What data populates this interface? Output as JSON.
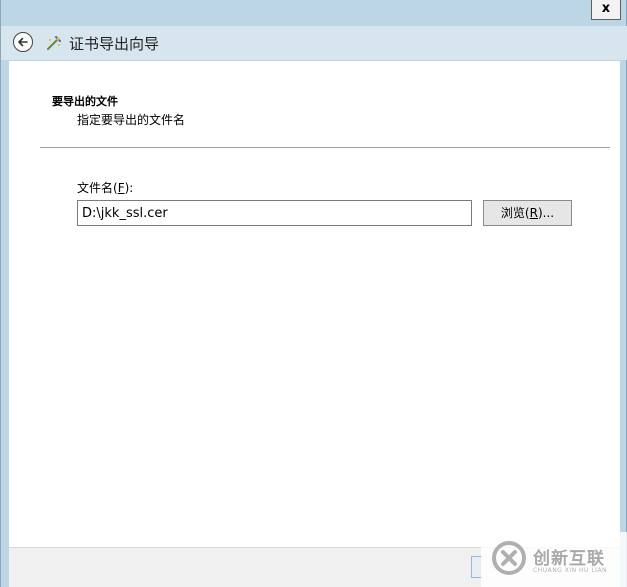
{
  "window": {
    "close_label": "x"
  },
  "nav": {
    "title": "证书导出向导",
    "back_icon": "back-arrow-icon",
    "wizard_icon": "certificate-wizard-icon"
  },
  "page": {
    "heading": "要导出的文件",
    "subheading": "指定要导出的文件名"
  },
  "form": {
    "filename_label_prefix": "文件名(",
    "filename_label_access_key": "F",
    "filename_label_suffix": "):",
    "filename_value": "D:\\jkk_ssl.cer",
    "browse_label_prefix": "浏览(",
    "browse_label_access_key": "R",
    "browse_label_suffix": ")..."
  },
  "watermark": {
    "name": "创新互联",
    "sub": "CHUANG XIN HU LIAN"
  },
  "colors": {
    "frame": "#bcd6e6",
    "navbar": "#d7e5ee",
    "content": "#ffffff",
    "footer": "#f0f0f0"
  }
}
